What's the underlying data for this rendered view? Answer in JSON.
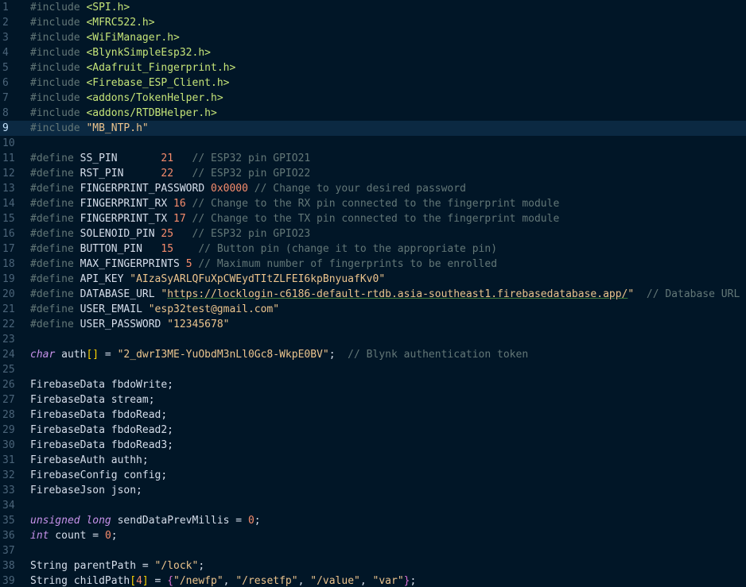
{
  "editor": {
    "current_line": 9,
    "lines": [
      {
        "n": "1",
        "tokens": [
          [
            "t-pre",
            "#include "
          ],
          [
            "t-inc",
            "<SPI.h>"
          ]
        ]
      },
      {
        "n": "2",
        "tokens": [
          [
            "t-pre",
            "#include "
          ],
          [
            "t-inc",
            "<MFRC522.h>"
          ]
        ]
      },
      {
        "n": "3",
        "tokens": [
          [
            "t-pre",
            "#include "
          ],
          [
            "t-inc",
            "<WiFiManager.h>"
          ]
        ]
      },
      {
        "n": "4",
        "tokens": [
          [
            "t-pre",
            "#include "
          ],
          [
            "t-inc",
            "<BlynkSimpleEsp32.h>"
          ]
        ]
      },
      {
        "n": "5",
        "tokens": [
          [
            "t-pre",
            "#include "
          ],
          [
            "t-inc",
            "<Adafruit_Fingerprint.h>"
          ]
        ]
      },
      {
        "n": "6",
        "tokens": [
          [
            "t-pre",
            "#include "
          ],
          [
            "t-inc",
            "<Firebase_ESP_Client.h>"
          ]
        ]
      },
      {
        "n": "7",
        "tokens": [
          [
            "t-pre",
            "#include "
          ],
          [
            "t-inc",
            "<addons/TokenHelper.h>"
          ]
        ]
      },
      {
        "n": "8",
        "tokens": [
          [
            "t-pre",
            "#include "
          ],
          [
            "t-inc",
            "<addons/RTDBHelper.h>"
          ]
        ]
      },
      {
        "n": "9",
        "tokens": [
          [
            "t-pre",
            "#include "
          ],
          [
            "t-str",
            "\"MB_NTP.h\""
          ]
        ]
      },
      {
        "n": "10",
        "tokens": []
      },
      {
        "n": "11",
        "tokens": [
          [
            "t-pre",
            "#define "
          ],
          [
            "t-def",
            "SS_PIN       "
          ],
          [
            "t-num",
            "21"
          ],
          [
            "t-cmt",
            "   // ESP32 pin GPIO21"
          ]
        ]
      },
      {
        "n": "12",
        "tokens": [
          [
            "t-pre",
            "#define "
          ],
          [
            "t-def",
            "RST_PIN      "
          ],
          [
            "t-num",
            "22"
          ],
          [
            "t-cmt",
            "   // ESP32 pin GPIO22"
          ]
        ]
      },
      {
        "n": "13",
        "tokens": [
          [
            "t-pre",
            "#define "
          ],
          [
            "t-def",
            "FINGERPRINT_PASSWORD "
          ],
          [
            "t-num",
            "0x0000"
          ],
          [
            "t-cmt",
            " // Change to your desired password"
          ]
        ]
      },
      {
        "n": "14",
        "tokens": [
          [
            "t-pre",
            "#define "
          ],
          [
            "t-def",
            "FINGERPRINT_RX "
          ],
          [
            "t-num",
            "16"
          ],
          [
            "t-cmt",
            " // Change to the RX pin connected to the fingerprint module"
          ]
        ]
      },
      {
        "n": "15",
        "tokens": [
          [
            "t-pre",
            "#define "
          ],
          [
            "t-def",
            "FINGERPRINT_TX "
          ],
          [
            "t-num",
            "17"
          ],
          [
            "t-cmt",
            " // Change to the TX pin connected to the fingerprint module"
          ]
        ]
      },
      {
        "n": "16",
        "tokens": [
          [
            "t-pre",
            "#define "
          ],
          [
            "t-def",
            "SOLENOID_PIN "
          ],
          [
            "t-num",
            "25"
          ],
          [
            "t-cmt",
            "   // ESP32 pin GPIO23"
          ]
        ]
      },
      {
        "n": "17",
        "tokens": [
          [
            "t-pre",
            "#define "
          ],
          [
            "t-def",
            "BUTTON_PIN   "
          ],
          [
            "t-num",
            "15"
          ],
          [
            "t-cmt",
            "    // Button pin (change it to the appropriate pin)"
          ]
        ]
      },
      {
        "n": "18",
        "tokens": [
          [
            "t-pre",
            "#define "
          ],
          [
            "t-def",
            "MAX_FINGERPRINTS "
          ],
          [
            "t-num",
            "5"
          ],
          [
            "t-cmt",
            " // Maximum number of fingerprints to be enrolled"
          ]
        ]
      },
      {
        "n": "19",
        "tokens": [
          [
            "t-pre",
            "#define "
          ],
          [
            "t-def",
            "API_KEY "
          ],
          [
            "t-str",
            "\"AIzaSyARLQFuXpCWEydTItZLFEI6kpBnyuafKv0\""
          ]
        ]
      },
      {
        "n": "20",
        "tokens": [
          [
            "t-pre",
            "#define "
          ],
          [
            "t-def",
            "DATABASE_URL "
          ],
          [
            "t-str",
            "\""
          ],
          [
            "t-url",
            "https://locklogin-c6186-default-rtdb.asia-southeast1.firebasedatabase.app/"
          ],
          [
            "t-str",
            "\""
          ],
          [
            "t-cmt",
            "  // Database URL"
          ]
        ]
      },
      {
        "n": "21",
        "tokens": [
          [
            "t-pre",
            "#define "
          ],
          [
            "t-def",
            "USER_EMAIL "
          ],
          [
            "t-str",
            "\"esp32test@gmail.com\""
          ]
        ]
      },
      {
        "n": "22",
        "tokens": [
          [
            "t-pre",
            "#define "
          ],
          [
            "t-def",
            "USER_PASSWORD "
          ],
          [
            "t-str",
            "\"12345678\""
          ]
        ]
      },
      {
        "n": "23",
        "tokens": []
      },
      {
        "n": "24",
        "tokens": [
          [
            "t-kw",
            "char"
          ],
          [
            "t-def",
            " auth"
          ],
          [
            "t-br1",
            "[]"
          ],
          [
            "t-pun",
            " = "
          ],
          [
            "t-str",
            "\"2_dwrI3ME-YuObdM3nLl0Gc8-WkpE0BV\""
          ],
          [
            "t-pun",
            ";"
          ],
          [
            "t-cmt",
            "  // Blynk authentication token"
          ]
        ]
      },
      {
        "n": "25",
        "tokens": []
      },
      {
        "n": "26",
        "tokens": [
          [
            "t-def",
            "FirebaseData fbdoWrite;"
          ]
        ]
      },
      {
        "n": "27",
        "tokens": [
          [
            "t-def",
            "FirebaseData stream;"
          ]
        ]
      },
      {
        "n": "28",
        "tokens": [
          [
            "t-def",
            "FirebaseData fbdoRead;"
          ]
        ]
      },
      {
        "n": "29",
        "tokens": [
          [
            "t-def",
            "FirebaseData fbdoRead2;"
          ]
        ]
      },
      {
        "n": "30",
        "tokens": [
          [
            "t-def",
            "FirebaseData fbdoRead3;"
          ]
        ]
      },
      {
        "n": "31",
        "tokens": [
          [
            "t-def",
            "FirebaseAuth authh;"
          ]
        ]
      },
      {
        "n": "32",
        "tokens": [
          [
            "t-def",
            "FirebaseConfig config;"
          ]
        ]
      },
      {
        "n": "33",
        "tokens": [
          [
            "t-def",
            "FirebaseJson json;"
          ]
        ]
      },
      {
        "n": "34",
        "tokens": []
      },
      {
        "n": "35",
        "tokens": [
          [
            "t-kw",
            "unsigned"
          ],
          [
            "t-def",
            " "
          ],
          [
            "t-kw",
            "long"
          ],
          [
            "t-def",
            " sendDataPrevMillis"
          ],
          [
            "t-pun",
            " = "
          ],
          [
            "t-num",
            "0"
          ],
          [
            "t-pun",
            ";"
          ]
        ]
      },
      {
        "n": "36",
        "tokens": [
          [
            "t-kw",
            "int"
          ],
          [
            "t-def",
            " count"
          ],
          [
            "t-pun",
            " = "
          ],
          [
            "t-num",
            "0"
          ],
          [
            "t-pun",
            ";"
          ]
        ]
      },
      {
        "n": "37",
        "tokens": []
      },
      {
        "n": "38",
        "tokens": [
          [
            "t-def",
            "String parentPath"
          ],
          [
            "t-pun",
            " = "
          ],
          [
            "t-str",
            "\"/lock\""
          ],
          [
            "t-pun",
            ";"
          ]
        ]
      },
      {
        "n": "39",
        "tokens": [
          [
            "t-def",
            "String childPath"
          ],
          [
            "t-br1",
            "["
          ],
          [
            "t-num",
            "4"
          ],
          [
            "t-br1",
            "]"
          ],
          [
            "t-pun",
            " = "
          ],
          [
            "t-br2",
            "{"
          ],
          [
            "t-str",
            "\"/newfp\""
          ],
          [
            "t-pun",
            ", "
          ],
          [
            "t-str",
            "\"/resetfp\""
          ],
          [
            "t-pun",
            ", "
          ],
          [
            "t-str",
            "\"/value\""
          ],
          [
            "t-pun",
            ", "
          ],
          [
            "t-str",
            "\"var\""
          ],
          [
            "t-br2",
            "}"
          ],
          [
            "t-pun",
            ";"
          ]
        ]
      }
    ]
  }
}
